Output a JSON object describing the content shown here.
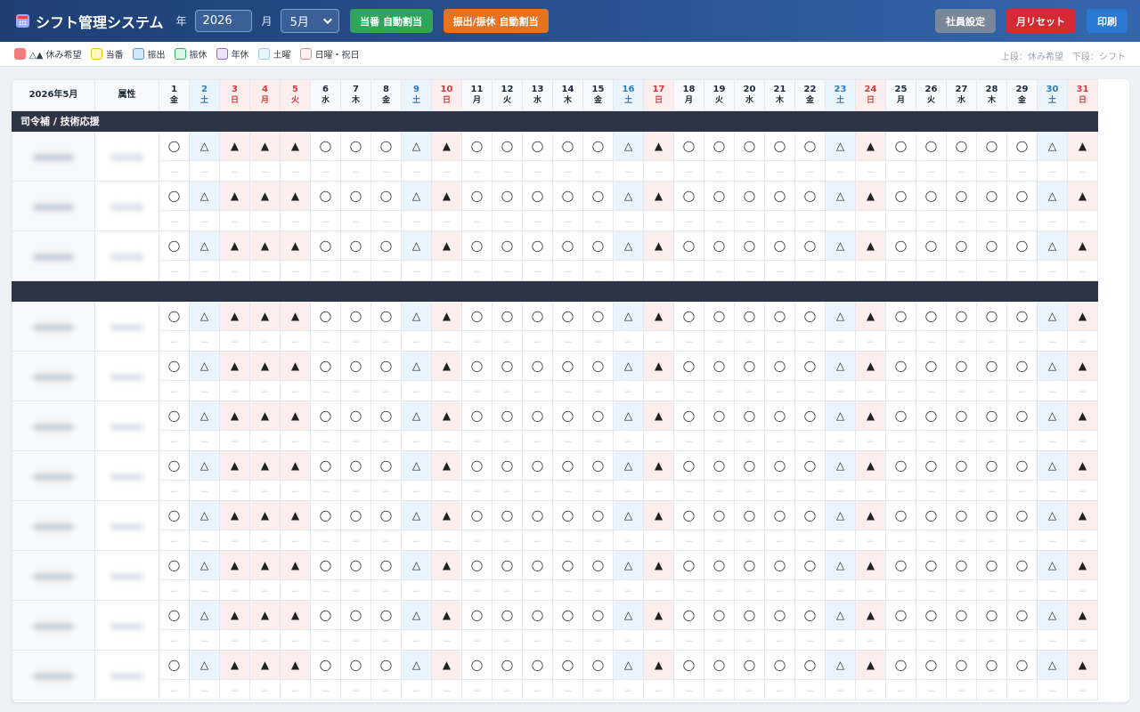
{
  "header": {
    "title": "シフト管理システム",
    "year_label": "年",
    "year_value": "2026",
    "month_label": "月",
    "month_value": "5月",
    "btn_auto_duty": "当番 自動割当",
    "btn_auto_swap": "振出/振休 自動割当",
    "btn_staff": "社員設定",
    "btn_reset": "月リセット",
    "btn_print": "印刷"
  },
  "legend": {
    "items": [
      {
        "label": "△▲ 休み希望",
        "color": "#f47c7c",
        "border": "#f47c7c"
      },
      {
        "label": "当番",
        "color": "#fff8c6",
        "border": "#e8c400"
      },
      {
        "label": "振出",
        "color": "#cfe8fb",
        "border": "#4a9bd8"
      },
      {
        "label": "振休",
        "color": "#dcf5e3",
        "border": "#3fae65"
      },
      {
        "label": "年休",
        "color": "#ebe3fb",
        "border": "#8b6ad8"
      },
      {
        "label": "土曜",
        "color": "#eaf5fd",
        "border": "#9ccae9"
      },
      {
        "label": "日曜・祝日",
        "color": "#fff1f1",
        "border": "#e68b8b"
      }
    ],
    "note": "上段：休み希望　下段：シフト"
  },
  "table": {
    "corner": "2026年5月",
    "attr_header": "属性",
    "days": [
      {
        "d": "1",
        "w": "金",
        "t": ""
      },
      {
        "d": "2",
        "w": "土",
        "t": "sat"
      },
      {
        "d": "3",
        "w": "日",
        "t": "sun"
      },
      {
        "d": "4",
        "w": "月",
        "t": "sun"
      },
      {
        "d": "5",
        "w": "火",
        "t": "sun"
      },
      {
        "d": "6",
        "w": "水",
        "t": ""
      },
      {
        "d": "7",
        "w": "木",
        "t": ""
      },
      {
        "d": "8",
        "w": "金",
        "t": ""
      },
      {
        "d": "9",
        "w": "土",
        "t": "sat"
      },
      {
        "d": "10",
        "w": "日",
        "t": "sun"
      },
      {
        "d": "11",
        "w": "月",
        "t": ""
      },
      {
        "d": "12",
        "w": "火",
        "t": ""
      },
      {
        "d": "13",
        "w": "水",
        "t": ""
      },
      {
        "d": "14",
        "w": "木",
        "t": ""
      },
      {
        "d": "15",
        "w": "金",
        "t": ""
      },
      {
        "d": "16",
        "w": "土",
        "t": "sat"
      },
      {
        "d": "17",
        "w": "日",
        "t": "sun"
      },
      {
        "d": "18",
        "w": "月",
        "t": ""
      },
      {
        "d": "19",
        "w": "火",
        "t": ""
      },
      {
        "d": "20",
        "w": "水",
        "t": ""
      },
      {
        "d": "21",
        "w": "木",
        "t": ""
      },
      {
        "d": "22",
        "w": "金",
        "t": ""
      },
      {
        "d": "23",
        "w": "土",
        "t": "sat"
      },
      {
        "d": "24",
        "w": "日",
        "t": "sun"
      },
      {
        "d": "25",
        "w": "月",
        "t": ""
      },
      {
        "d": "26",
        "w": "火",
        "t": ""
      },
      {
        "d": "27",
        "w": "水",
        "t": ""
      },
      {
        "d": "28",
        "w": "木",
        "t": ""
      },
      {
        "d": "29",
        "w": "金",
        "t": ""
      },
      {
        "d": "30",
        "w": "土",
        "t": "sat"
      },
      {
        "d": "31",
        "w": "日",
        "t": "sun"
      }
    ],
    "marks": {
      "": "◯",
      "sat": "△",
      "sun": "▲"
    },
    "empty_mark": "－",
    "sections": [
      {
        "title": "司令補 / 技術応援",
        "rows": 3,
        "accent": "#c7d7f2"
      },
      {
        "title": "",
        "rows": 8,
        "accent": "#cdebd3"
      }
    ]
  }
}
